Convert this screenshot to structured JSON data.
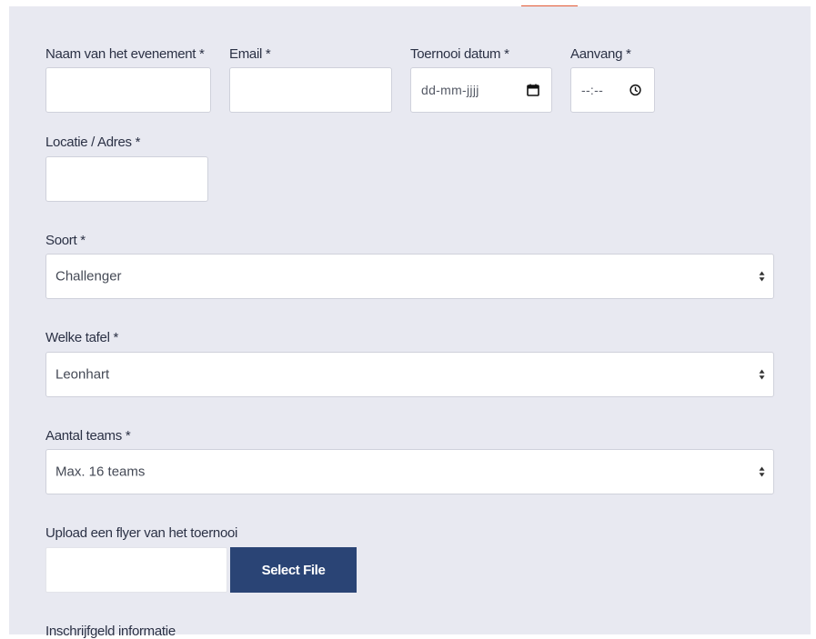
{
  "form": {
    "event_name": {
      "label": "Naam van het evenement *",
      "value": ""
    },
    "email": {
      "label": "Email *",
      "value": ""
    },
    "tournament_date": {
      "label": "Toernooi datum *",
      "placeholder": "dd-mm-jjjj"
    },
    "start_time": {
      "label": "Aanvang *",
      "placeholder": "--:--"
    },
    "location": {
      "label": "Locatie / Adres *",
      "value": ""
    },
    "kind": {
      "label": "Soort *",
      "selected": "Challenger"
    },
    "table": {
      "label": "Welke tafel *",
      "selected": "Leonhart"
    },
    "team_count": {
      "label": "Aantal teams *",
      "selected": "Max. 16 teams"
    },
    "upload": {
      "label": "Upload een flyer van het toernooi",
      "button_label": "Select File"
    },
    "fee_info": {
      "label": "Inschrijfgeld informatie"
    }
  },
  "colors": {
    "panel_bg": "#e8e9f1",
    "button_bg": "#2a4475",
    "accent": "#e35a35"
  }
}
